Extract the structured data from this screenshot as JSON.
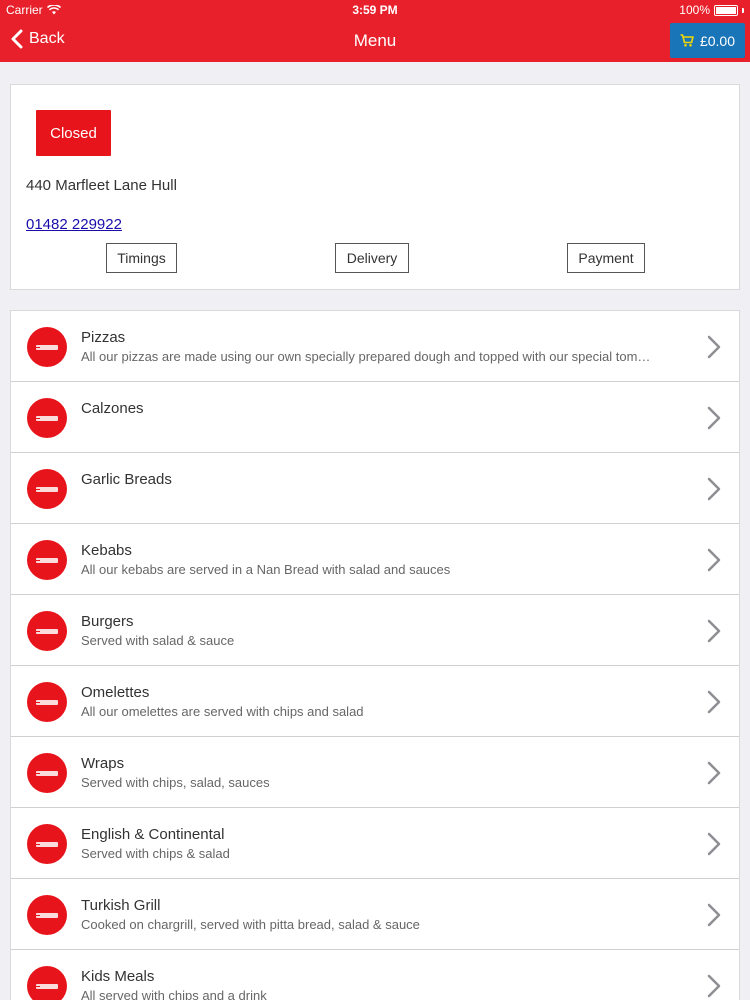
{
  "status_bar": {
    "carrier": "Carrier",
    "time": "3:59 PM",
    "battery": "100%"
  },
  "nav": {
    "back_label": "Back",
    "title": "Menu",
    "cart_total": "£0.00"
  },
  "restaurant": {
    "status": "Closed",
    "address": "440 Marfleet Lane Hull",
    "phone": "01482 229922",
    "tabs": [
      "Timings",
      "Delivery",
      "Payment"
    ]
  },
  "categories": [
    {
      "name": "Pizzas",
      "description": "All our pizzas are made using our own specially prepared dough and topped with our special tom…"
    },
    {
      "name": "Calzones",
      "description": ""
    },
    {
      "name": "Garlic Breads",
      "description": ""
    },
    {
      "name": "Kebabs",
      "description": "All our kebabs are served in a Nan Bread with salad and sauces"
    },
    {
      "name": "Burgers",
      "description": "Served with salad & sauce"
    },
    {
      "name": "Omelettes",
      "description": "All our omelettes are served with chips and salad"
    },
    {
      "name": "Wraps",
      "description": "Served with chips, salad, sauces"
    },
    {
      "name": "English & Continental",
      "description": "Served with chips & salad"
    },
    {
      "name": "Turkish Grill",
      "description": "Cooked on chargrill, served with pitta bread, salad & sauce"
    },
    {
      "name": "Kids Meals",
      "description": "All served with chips and a drink"
    }
  ],
  "colors": {
    "brand_red": "#e8202b",
    "cart_blue": "#1a74b8",
    "link_blue": "#1a0dab"
  },
  "icons": {
    "back": "chevron-left-icon",
    "cart": "cart-icon",
    "row": "chevron-right-icon",
    "logo": "restaurant-logo"
  }
}
